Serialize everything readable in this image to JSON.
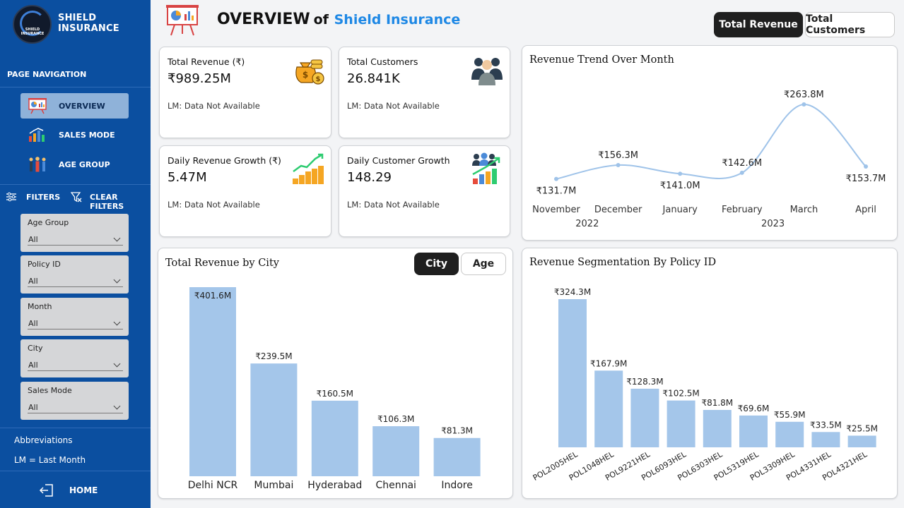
{
  "brand": {
    "name": "SHIELD INSURANCE",
    "logo_text": "SHIELD INSURANCE"
  },
  "sidebar": {
    "nav_title": "PAGE NAVIGATION",
    "nav": [
      {
        "label": "OVERVIEW",
        "icon": "presentation-icon",
        "active": true
      },
      {
        "label": "SALES MODE",
        "icon": "bar-chart-icon",
        "active": false
      },
      {
        "label": "AGE GROUP",
        "icon": "people-group-icon",
        "active": false
      }
    ],
    "filters_label": "FILTERS",
    "clear_filters_label": "CLEAR FILTERS",
    "filters": [
      {
        "label": "Age Group",
        "value": "All"
      },
      {
        "label": "Policy ID",
        "value": "All"
      },
      {
        "label": "Month",
        "value": "All"
      },
      {
        "label": "City",
        "value": "All"
      },
      {
        "label": "Sales Mode",
        "value": "All"
      }
    ],
    "abbr_title": "Abbreviations",
    "abbr_text": "LM = Last Month",
    "home_label": "HOME"
  },
  "header": {
    "title": "OVERVIEW",
    "of": "of",
    "brand": "Shield Insurance",
    "toggle": {
      "revenue": "Total Revenue",
      "customers": "Total Customers",
      "selected": "revenue"
    }
  },
  "kpis": [
    {
      "title": "Total Revenue (₹)",
      "value": "₹989.25M",
      "lm": "LM: Data Not Available",
      "icon": "money-bags-icon"
    },
    {
      "title": "Total Customers",
      "value": "26.841K",
      "lm": "LM: Data Not Available",
      "icon": "customers-icon"
    },
    {
      "title": "Daily Revenue Growth (₹)",
      "value": "5.47M",
      "lm": "LM: Data Not Available",
      "icon": "coin-growth-icon"
    },
    {
      "title": "Daily Customer Growth",
      "value": "148.29",
      "lm": "LM: Data Not Available",
      "icon": "customer-growth-icon"
    }
  ],
  "colors": {
    "sidebar": "#0b4fa0",
    "bar": "#a4c6ea",
    "line": "#9fc3e9",
    "accent": "#1e88e5"
  },
  "chart_data": [
    {
      "type": "line",
      "title": "Revenue Trend Over Month",
      "x": [
        "November",
        "December",
        "January",
        "February",
        "March",
        "April"
      ],
      "year_labels": [
        "2022",
        "2023"
      ],
      "values": [
        131.7,
        156.3,
        141.0,
        142.6,
        263.8,
        153.7
      ],
      "data_labels": [
        "₹131.7M",
        "₹156.3M",
        "₹141.0M",
        "₹142.6M",
        "₹263.8M",
        "₹153.7M"
      ],
      "grid": false
    },
    {
      "type": "bar",
      "title": "Total Revenue by City",
      "toggle": {
        "city": "City",
        "age": "Age",
        "selected": "city"
      },
      "categories": [
        "Delhi NCR",
        "Mumbai",
        "Hyderabad",
        "Chennai",
        "Indore"
      ],
      "values": [
        401.6,
        239.5,
        160.5,
        106.3,
        81.3
      ],
      "data_labels": [
        "₹401.6M",
        "₹239.5M",
        "₹160.5M",
        "₹106.3M",
        "₹81.3M"
      ],
      "grid": false
    },
    {
      "type": "bar",
      "title": "Revenue Segmentation By Policy ID",
      "categories": [
        "POL2005HEL",
        "POL1048HEL",
        "POL9221HEL",
        "POL6093HEL",
        "POL6303HEL",
        "POL5319HEL",
        "POL3309HEL",
        "POL4331HEL",
        "POL4321HEL"
      ],
      "values": [
        324.3,
        167.9,
        128.3,
        102.5,
        81.8,
        69.6,
        55.9,
        33.5,
        25.5
      ],
      "data_labels": [
        "₹324.3M",
        "₹167.9M",
        "₹128.3M",
        "₹102.5M",
        "₹81.8M",
        "₹69.6M",
        "₹55.9M",
        "₹33.5M",
        "₹25.5M"
      ],
      "grid": false
    }
  ]
}
